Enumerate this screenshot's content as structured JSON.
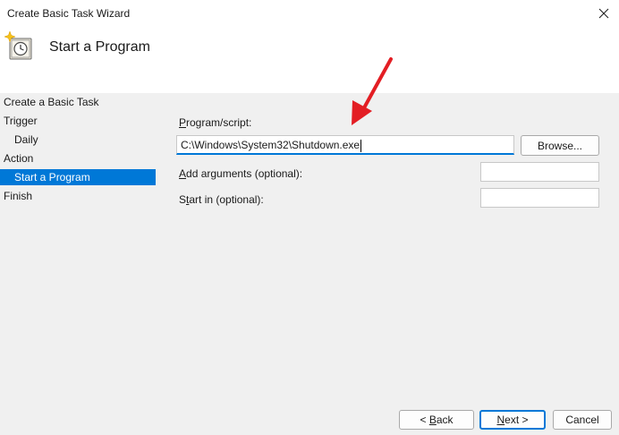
{
  "window": {
    "title": "Create Basic Task Wizard"
  },
  "header": {
    "title": "Start a Program",
    "icon": "task-scheduler-clock-icon"
  },
  "sidebar": {
    "steps": [
      {
        "label": "Create a Basic Task",
        "level": 0,
        "selected": false
      },
      {
        "label": "Trigger",
        "level": 0,
        "selected": false
      },
      {
        "label": "Daily",
        "level": 1,
        "selected": false
      },
      {
        "label": "Action",
        "level": 0,
        "selected": false
      },
      {
        "label": "Start a Program",
        "level": 1,
        "selected": true
      },
      {
        "label": "Finish",
        "level": 0,
        "selected": false
      }
    ]
  },
  "form": {
    "program": {
      "label_accesskey": "P",
      "label_rest": "rogram/script:",
      "value": "C:\\Windows\\System32\\Shutdown.exe",
      "browse_label": "Browse..."
    },
    "arguments": {
      "label_accesskey": "A",
      "label_rest": "dd arguments (optional):",
      "value": ""
    },
    "start_in": {
      "label_accesskey": "t",
      "label_pre": "S",
      "label_rest": "art in (optional):",
      "value": ""
    }
  },
  "buttons": {
    "back": {
      "prefix": "< ",
      "accesskey": "B",
      "rest": "ack"
    },
    "next": {
      "accesskey": "N",
      "rest": "ext >"
    },
    "cancel": "Cancel"
  },
  "colors": {
    "accent": "#0078d7",
    "annotation_arrow": "#e31e24"
  }
}
